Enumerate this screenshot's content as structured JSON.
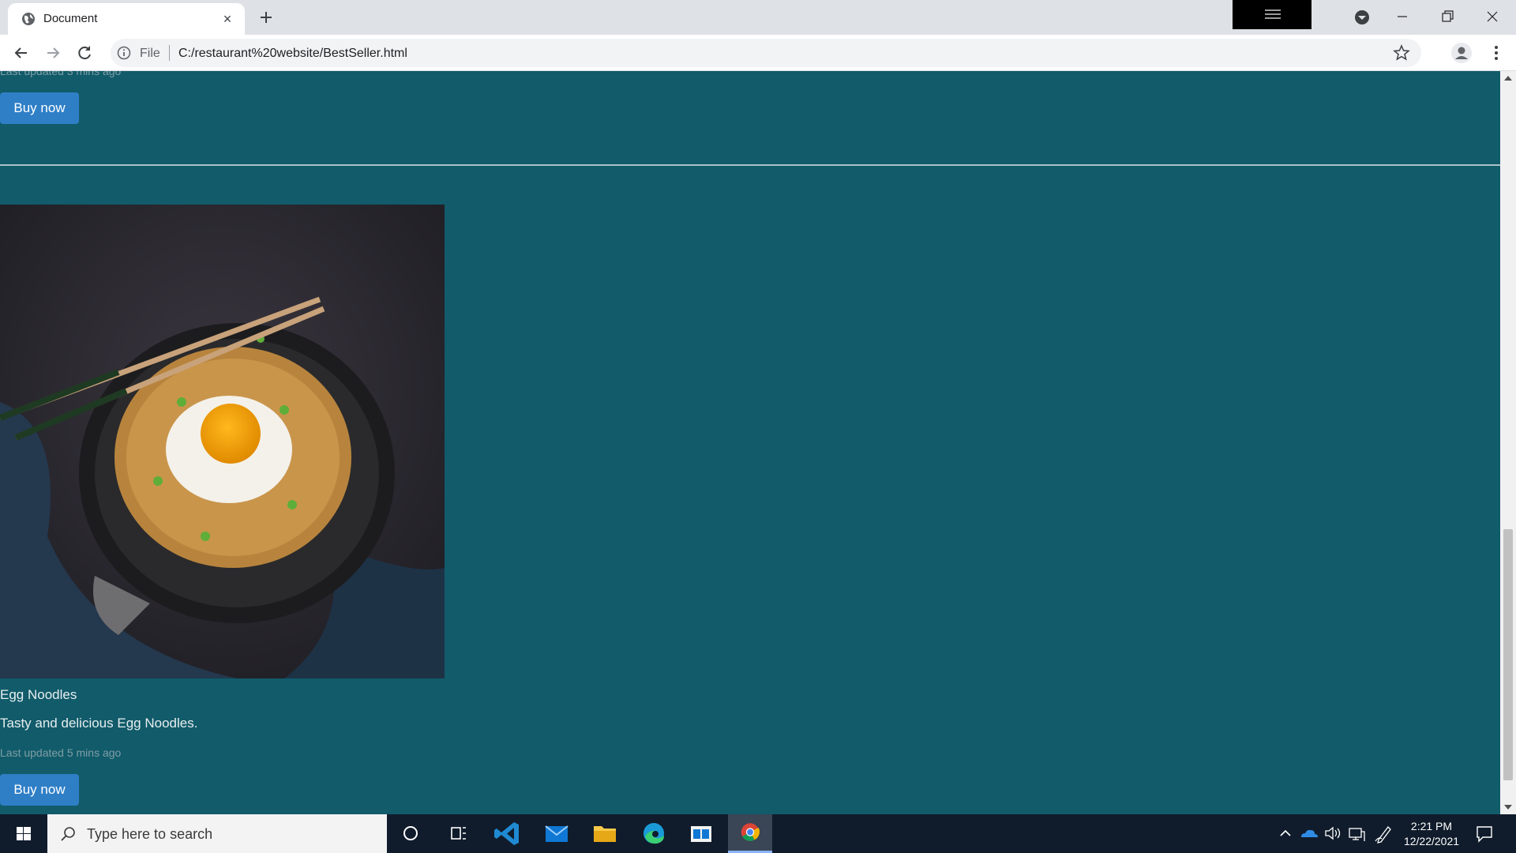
{
  "browser": {
    "tab_title": "Document",
    "tab_close": "×",
    "address_scheme": "File",
    "address_url": "C:/restaurant%20website/BestSeller.html"
  },
  "page": {
    "top_last_updated": "Last updated 3 mins ago",
    "top_buy_label": "Buy now",
    "dish": {
      "image_alt": "Egg Noodles",
      "name": "Egg Noodles",
      "description": "Tasty and delicious Egg Noodles.",
      "last_updated": "Last updated 5 mins ago",
      "buy_label": "Buy now"
    }
  },
  "colors": {
    "page_background": "#115b6a",
    "button": "#2f7fc7",
    "taskbar": "#101c2c"
  },
  "taskbar": {
    "search_placeholder": "Type here to search",
    "time": "2:21 PM",
    "date": "12/22/2021",
    "apps": [
      "cortana-icon",
      "task-view-icon",
      "vscode-icon",
      "mail-icon",
      "file-explorer-icon",
      "edge-icon",
      "store-icon",
      "chrome-icon"
    ]
  }
}
